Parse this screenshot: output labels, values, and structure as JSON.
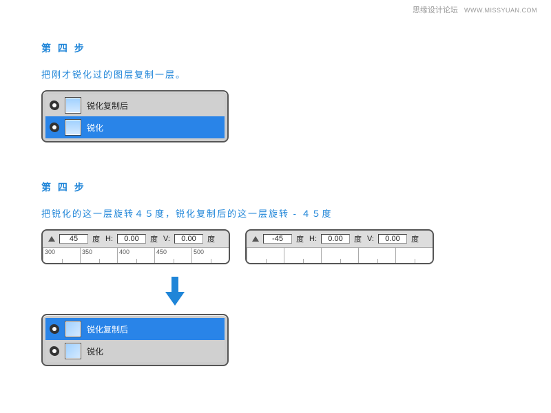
{
  "watermark": {
    "cn": "思缘设计论坛",
    "en": "WWW.MISSYUAN.COM"
  },
  "step1": {
    "title": "第 四 步",
    "desc": "把刚才锐化过的图层复制一层。",
    "layers": [
      {
        "name": "锐化复制后"
      },
      {
        "name": "锐化"
      }
    ]
  },
  "step2": {
    "title": "第 四 步",
    "desc": "把锐化的这一层旋转４５度，锐化复制后的这一层旋转 - ４５度",
    "tb1": {
      "angle": "45",
      "unit": "度",
      "h": "0.00",
      "v": "0.00",
      "ruler": [
        "300",
        "350",
        "400",
        "450",
        "500"
      ]
    },
    "tb2": {
      "angle": "-45",
      "unit": "度",
      "h": "0.00",
      "v": "0.00",
      "ruler": [
        "",
        "",
        "",
        "",
        ""
      ]
    },
    "layers": [
      {
        "name": "锐化复制后"
      },
      {
        "name": "锐化"
      }
    ]
  }
}
